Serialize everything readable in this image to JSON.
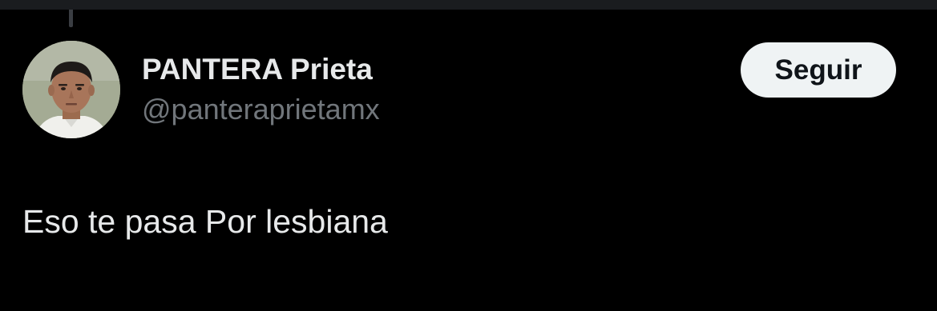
{
  "author": {
    "display_name": "PANTERA Prieta",
    "handle": "@panteraprietamx",
    "avatar_icon": "profile-photo"
  },
  "actions": {
    "follow_label": "Seguir"
  },
  "tweet": {
    "text": "Eso te pasa Por lesbiana"
  },
  "colors": {
    "background": "#000000",
    "primary_text": "#e7e9ea",
    "secondary_text": "#71767b",
    "button_bg": "#eff3f4",
    "button_text": "#0f1419"
  }
}
